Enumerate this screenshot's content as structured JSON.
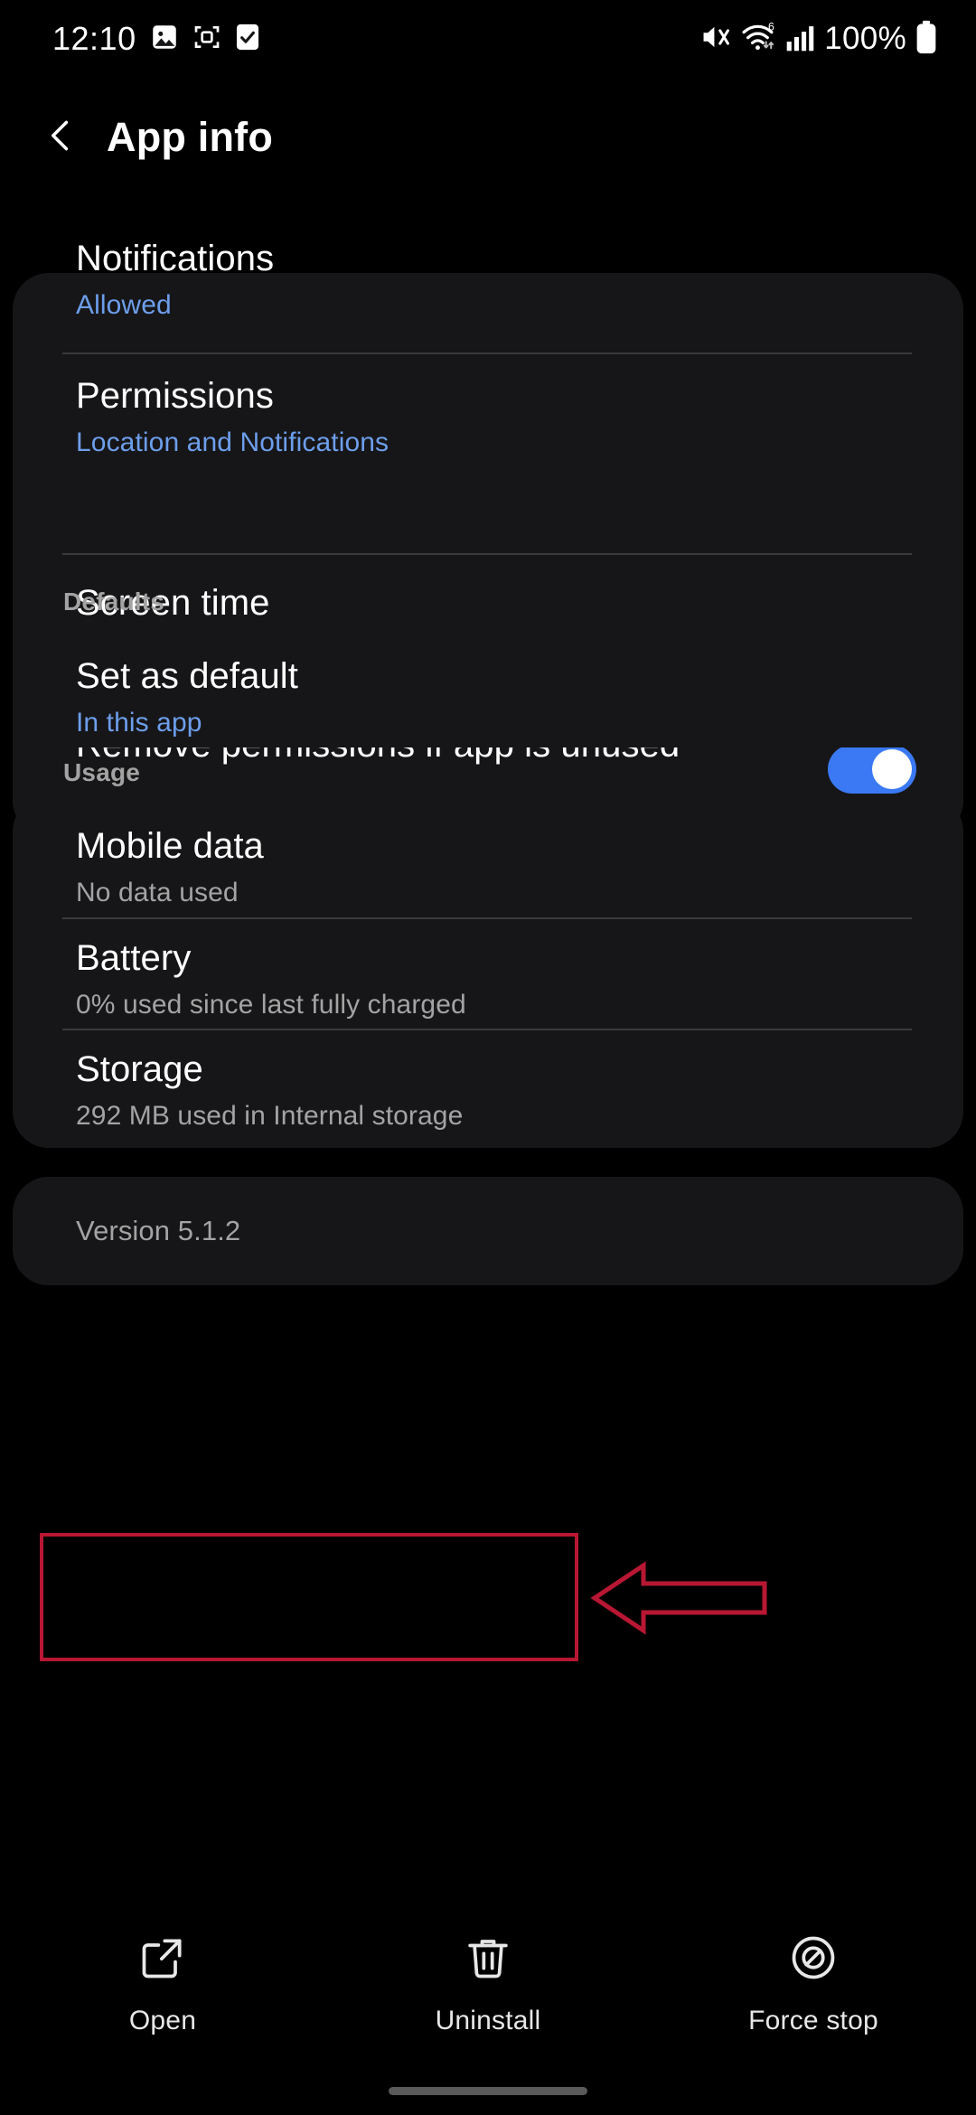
{
  "status_bar": {
    "time": "12:10",
    "battery_percent": "100%",
    "icons": [
      "image-icon",
      "screen-capture-icon",
      "checkbox-checked-icon",
      "mute-icon",
      "wifi-6-icon",
      "cellular-signal-icon",
      "battery-full-icon"
    ]
  },
  "header": {
    "title": "App info",
    "back_icon": "back-chevron-icon"
  },
  "settings": {
    "group1": [
      {
        "title": "Notifications",
        "subtitle": "Allowed",
        "subtitle_style": "blue",
        "control": "none"
      },
      {
        "title": "Permissions",
        "subtitle": "Location and Notifications",
        "subtitle_style": "blue",
        "control": "none"
      },
      {
        "title": "Screen time",
        "subtitle": "",
        "subtitle_style": "none",
        "control": "none"
      },
      {
        "title": "Remove permissions if app is unused",
        "subtitle": "",
        "subtitle_style": "none",
        "control": "toggle",
        "toggle_on": true
      }
    ],
    "defaults_label": "Defaults",
    "group2": [
      {
        "title": "Set as default",
        "subtitle": "In this app",
        "subtitle_style": "blue",
        "control": "none"
      }
    ],
    "usage_label": "Usage",
    "group3": [
      {
        "title": "Mobile data",
        "subtitle": "No data used",
        "subtitle_style": "gray",
        "control": "none"
      },
      {
        "title": "Battery",
        "subtitle": "0% used since last fully charged",
        "subtitle_style": "gray",
        "control": "none"
      },
      {
        "title": "Storage",
        "subtitle": "292 MB used in Internal storage",
        "subtitle_style": "gray",
        "control": "none",
        "highlighted": true
      }
    ],
    "version": "Version 5.1.2"
  },
  "annotation": {
    "shape": "red-rectangle-with-left-arrow",
    "color": "#b81733",
    "target": "Storage"
  },
  "bottom_bar": [
    {
      "label": "Open",
      "icon": "open-external-icon"
    },
    {
      "label": "Uninstall",
      "icon": "trash-icon"
    },
    {
      "label": "Force stop",
      "icon": "block-circle-icon"
    }
  ],
  "colors": {
    "background": "#000000",
    "card": "#161618",
    "accent_blue": "#6d9eeb",
    "toggle_on": "#3a79f3",
    "annotation_red": "#b81733",
    "secondary_text": "#a3a3a3"
  }
}
